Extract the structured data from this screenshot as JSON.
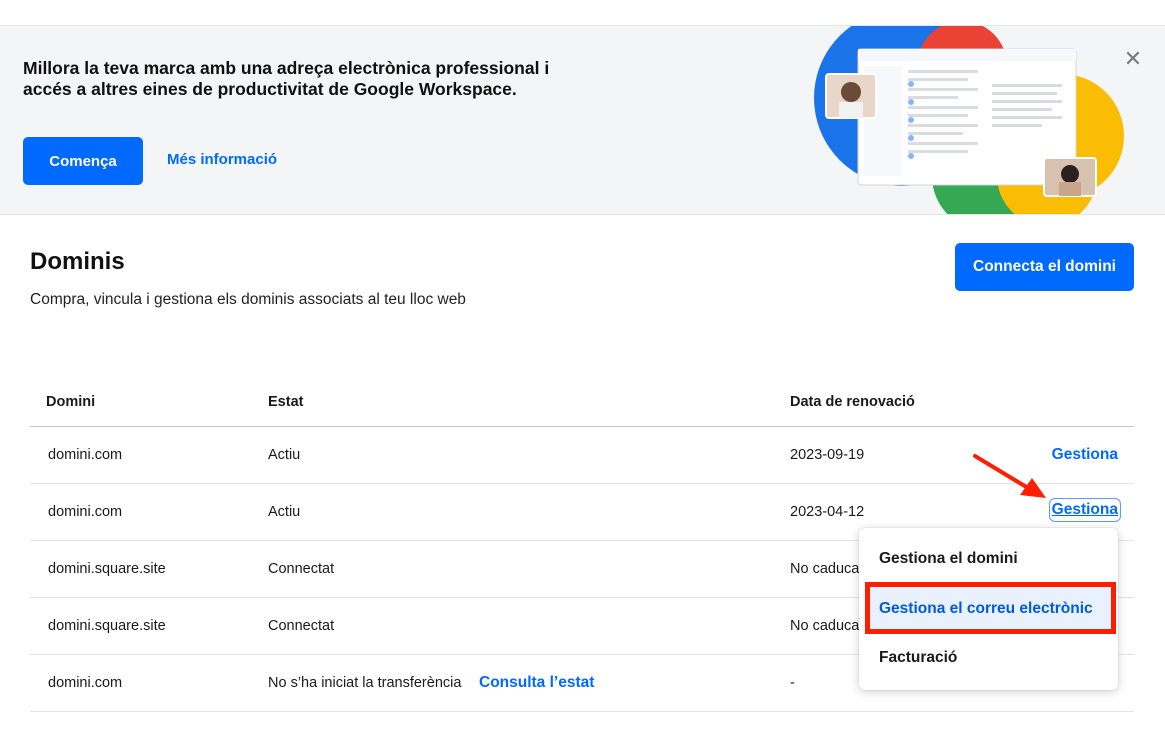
{
  "banner": {
    "title": "Millora la teva marca amb una adreça electrònica professional i accés a altres eines de productivitat de Google Workspace.",
    "start_button": "Comença",
    "more_info_link": "Més informació",
    "close_icon": "close-icon"
  },
  "page": {
    "title": "Dominis",
    "subtitle": "Compra, vincula i gestiona els dominis associats al teu lloc web",
    "connect_button": "Connecta el domini"
  },
  "table": {
    "headers": [
      "Domini",
      "Estat",
      "Data de renovació"
    ],
    "rows": [
      {
        "domain": "domini.com",
        "status": "Actiu",
        "renewal": "2023-09-19",
        "action": "Gestiona"
      },
      {
        "domain": "domini.com",
        "status": "Actiu",
        "renewal": "2023-04-12",
        "action": "Gestiona"
      },
      {
        "domain": "domini.square.site",
        "status": "Connectat",
        "renewal": "No caduca"
      },
      {
        "domain": "domini.square.site",
        "status": "Connectat",
        "renewal": "No caduca"
      },
      {
        "domain": "domini.com",
        "status": "No s’ha iniciat la transferència",
        "status_link": "Consulta l’estat",
        "renewal": "-"
      }
    ]
  },
  "dropdown": {
    "items": [
      "Gestiona el domini",
      "Gestiona el correu electrònic",
      "Facturació"
    ],
    "highlighted_index": 1
  },
  "colors": {
    "accent": "#006aff",
    "annotation": "#ff1e00"
  }
}
